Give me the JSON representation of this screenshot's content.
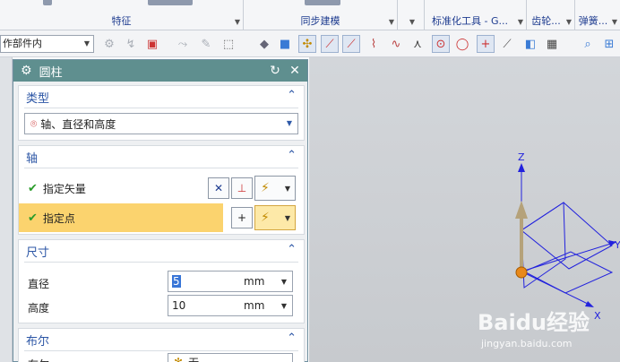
{
  "ribbon": {
    "groups": [
      {
        "label": "特征"
      },
      {
        "label": "同步建模"
      },
      {
        "label": "标准化工具 - G..."
      },
      {
        "label": "齿轮..."
      },
      {
        "label": "弹簧..."
      }
    ]
  },
  "toolbar": {
    "scope_combo": "作部件内"
  },
  "dialog": {
    "title": "圆柱",
    "type_section": {
      "heading": "类型",
      "selected": "轴、直径和高度"
    },
    "axis_section": {
      "heading": "轴",
      "specify_vector": "指定矢量",
      "specify_point": "指定点"
    },
    "dimensions_section": {
      "heading": "尺寸",
      "diameter_label": "直径",
      "diameter_value": "5",
      "diameter_unit": "mm",
      "height_label": "高度",
      "height_value": "10",
      "height_unit": "mm"
    },
    "boolean_section": {
      "heading": "布尔",
      "row_label": "布尔",
      "row_value": "无"
    }
  },
  "viewport": {
    "axis_z": "Z",
    "axis_y": "Y",
    "axis_x": "X",
    "watermark_brand": "Baidu经验",
    "watermark_url": "jingyan.baidu.com"
  },
  "colors": {
    "dialog_title_bg": "#5f8f8f",
    "section_heading": "#2b55a5",
    "highlight_row": "#fbd36e",
    "check_green": "#2a9c2a",
    "datum_blue": "#2222dd",
    "vector_tan": "#b5a27a",
    "origin_orange": "#e8891a"
  }
}
